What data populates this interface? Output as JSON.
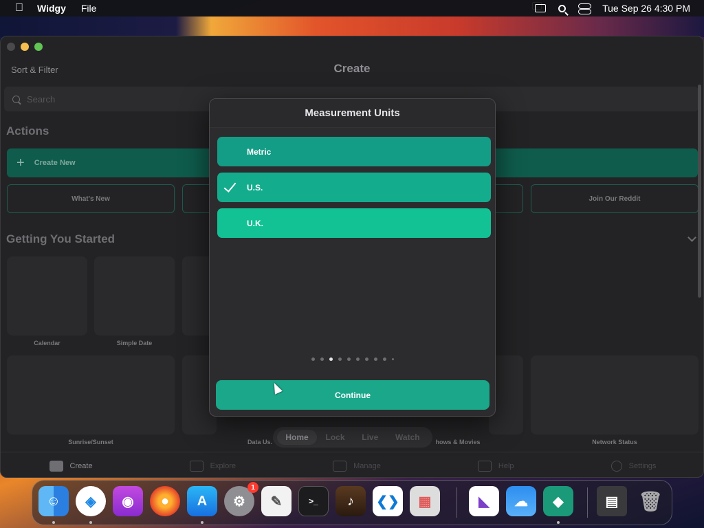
{
  "menubar": {
    "app_name": "Widgy",
    "menu_file": "File",
    "clock": "Tue Sep 26  4:30 PM"
  },
  "window": {
    "toolbar_left": "Sort & Filter",
    "title": "Create",
    "search_placeholder": "Search",
    "actions_title": "Actions",
    "create_new": "Create New",
    "action_buttons": [
      "What's New",
      "Join Our Reddit"
    ],
    "getting_started_title": "Getting You Started",
    "tiles": [
      "Calendar",
      "Simple Date",
      "Sunrise/Sunset",
      "Data Us.",
      "hows & Movies",
      "Network Status"
    ],
    "segments": [
      "Home",
      "Lock",
      "Live",
      "Watch"
    ],
    "tabs": [
      "Create",
      "Explore",
      "Manage",
      "Help",
      "Settings"
    ]
  },
  "modal": {
    "title": "Measurement Units",
    "options": [
      {
        "label": "Metric",
        "color": "#139c86"
      },
      {
        "label": "U.S.",
        "color": "#13ad8e",
        "selected": true
      },
      {
        "label": "U.K.",
        "color": "#12c294"
      }
    ],
    "continue": "Continue"
  },
  "dock": {
    "badge": "1",
    "apps": [
      "finder-icon",
      "safari-icon",
      "podcasts-icon",
      "firefox-icon",
      "app-store-icon",
      "system-settings-icon",
      "textedit-icon",
      "terminal-icon",
      "garageband-icon",
      "vscode-icon",
      "launchpad-icon",
      "visual-studio-icon",
      "weather-icon",
      "widgy-icon",
      "downloads-stack-icon",
      "trash-icon"
    ]
  }
}
